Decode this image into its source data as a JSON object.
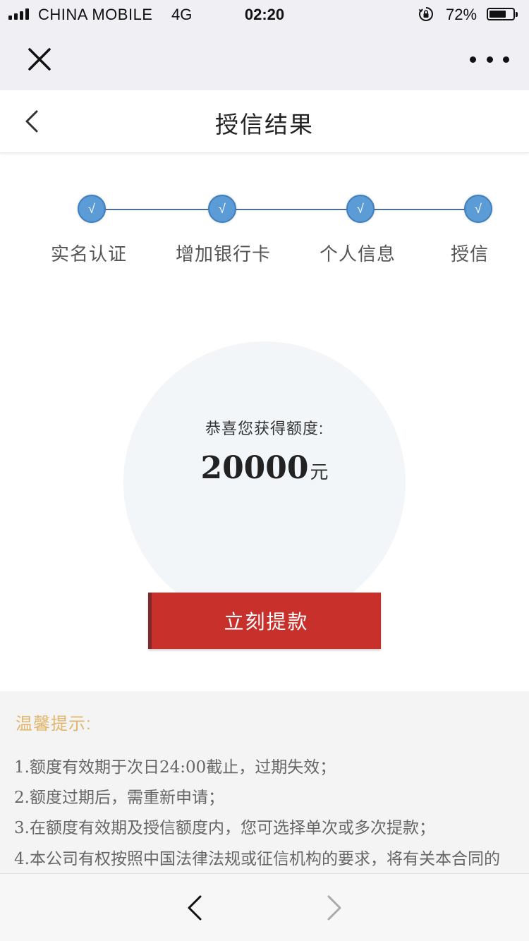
{
  "status_bar": {
    "carrier": "CHINA MOBILE",
    "network": "4G",
    "time": "02:20",
    "battery": "72%",
    "battery_level": 0.72,
    "icons": [
      "signal-icon",
      "orientation-lock-icon",
      "battery-icon"
    ]
  },
  "webview_bar": {
    "icons": [
      "close-icon",
      "more-icon"
    ]
  },
  "header": {
    "title": "授信结果",
    "icons": [
      "chevron-left-icon"
    ]
  },
  "steps": [
    {
      "label": "实名认证",
      "mark": "√",
      "done": true
    },
    {
      "label": "增加银行卡",
      "mark": "√",
      "done": true
    },
    {
      "label": "个人信息",
      "mark": "√",
      "done": true
    },
    {
      "label": "授信",
      "mark": "√",
      "done": true
    }
  ],
  "result": {
    "congrats": "恭喜您获得额度:",
    "amount": "20000",
    "unit": "元"
  },
  "withdraw_button": {
    "label": "立刻提款",
    "color": "#c8302c"
  },
  "tips": {
    "title": "温馨提示:",
    "items": [
      "1.额度有效期于次日24:00截止，过期失效；",
      "2.额度过期后，需重新申请；",
      "3.在额度有效期及授信额度内，您可选择单次或多次提款；",
      "4.本公司有权按照中国法律法规或征信机构的要求，将有关本合同的"
    ]
  },
  "bottom_nav": {
    "icons": [
      "nav-back-icon",
      "nav-forward-icon"
    ]
  },
  "colors": {
    "accent_red": "#c8302c",
    "step_blue": "#5b9bd6",
    "tips_title": "#e2b66a"
  }
}
